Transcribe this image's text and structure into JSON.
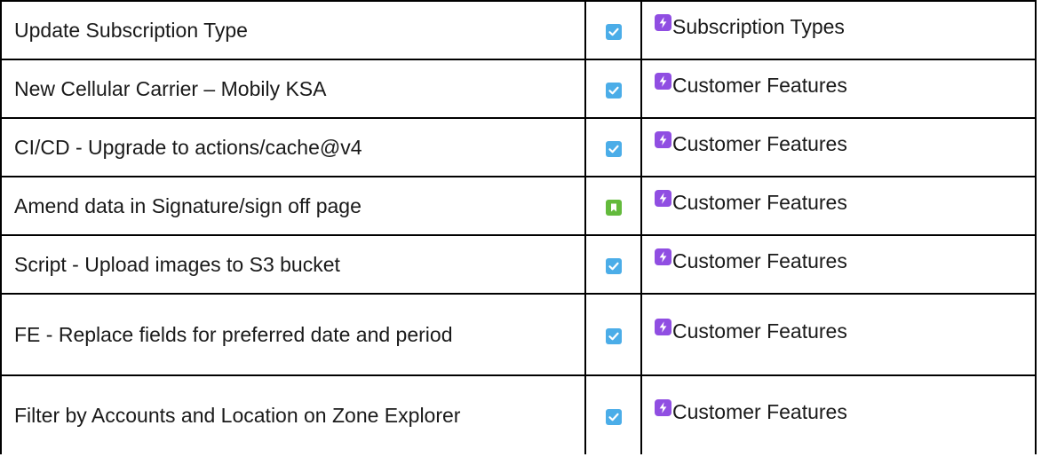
{
  "colors": {
    "task": "#4bade8",
    "story": "#63ba3c",
    "epic": "#904ee2",
    "border": "#000000",
    "text": "#1a1a1a"
  },
  "rows": [
    {
      "summary": "Update Subscription Type",
      "type_icon": "task-check-icon",
      "epic_icon": "epic-lightning-icon",
      "epic": "Subscription Types"
    },
    {
      "summary": "New Cellular Carrier – Mobily KSA",
      "type_icon": "task-check-icon",
      "epic_icon": "epic-lightning-icon",
      "epic": "Customer Features"
    },
    {
      "summary": "CI/CD - Upgrade to actions/cache@v4",
      "type_icon": "task-check-icon",
      "epic_icon": "epic-lightning-icon",
      "epic": "Customer Features"
    },
    {
      "summary": "Amend data in Signature/sign off page",
      "type_icon": "story-bookmark-icon",
      "epic_icon": "epic-lightning-icon",
      "epic": "Customer Features"
    },
    {
      "summary": "Script - Upload images to S3 bucket",
      "type_icon": "task-check-icon",
      "epic_icon": "epic-lightning-icon",
      "epic": "Customer Features"
    },
    {
      "summary": "FE - Replace fields for preferred date and period",
      "type_icon": "task-check-icon",
      "epic_icon": "epic-lightning-icon",
      "epic": "Customer Features"
    },
    {
      "summary": "Filter by Accounts and Location on Zone Explorer",
      "type_icon": "task-check-icon",
      "epic_icon": "epic-lightning-icon",
      "epic": "Customer Features"
    }
  ]
}
